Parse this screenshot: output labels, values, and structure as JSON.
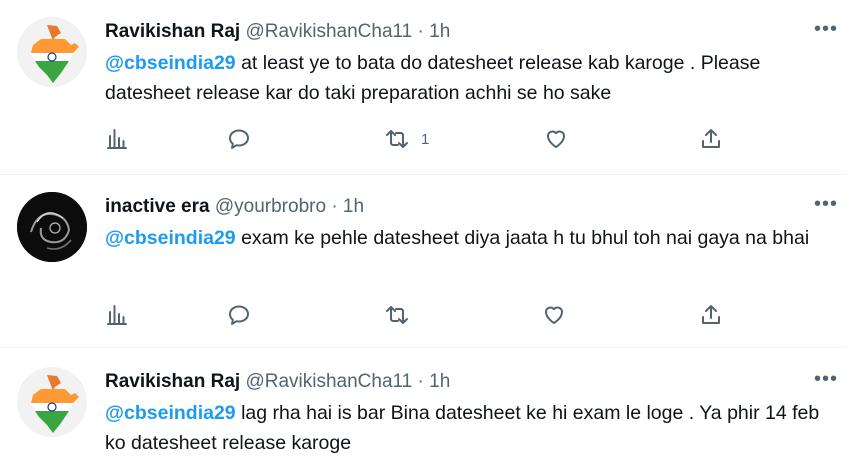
{
  "tweets": [
    {
      "name": "Ravikishan Raj",
      "handle": "@RavikishanCha11",
      "dot": "·",
      "time": "1h",
      "mention": "@cbseindia29",
      "text": " at least ye to bata do datesheet release kab karoge . Please datesheet release kar do taki  preparation achhi se ho sake",
      "retweets": "1",
      "avatar": "india-map-icon"
    },
    {
      "name": "inactive era",
      "handle": "@yourbrobro",
      "dot": "·",
      "time": "1h",
      "mention": "@cbseindia29",
      "text": " exam ke pehle datesheet diya jaata h tu bhul toh nai gaya na bhai",
      "retweets": "",
      "avatar": "dark-abstract-avatar"
    },
    {
      "name": "Ravikishan Raj",
      "handle": "@RavikishanCha11",
      "dot": "·",
      "time": "1h",
      "mention": "@cbseindia29",
      "text": " lag rha hai is bar Bina datesheet ke hi exam le loge . Ya phir 14 feb ko datesheet release karoge",
      "retweets": "",
      "avatar": "india-map-icon"
    }
  ],
  "more_glyph": "•••",
  "colors": {
    "accent": "#1d9bf0",
    "muted": "#536471",
    "text": "#0f1419",
    "divider": "#eff3f4"
  }
}
